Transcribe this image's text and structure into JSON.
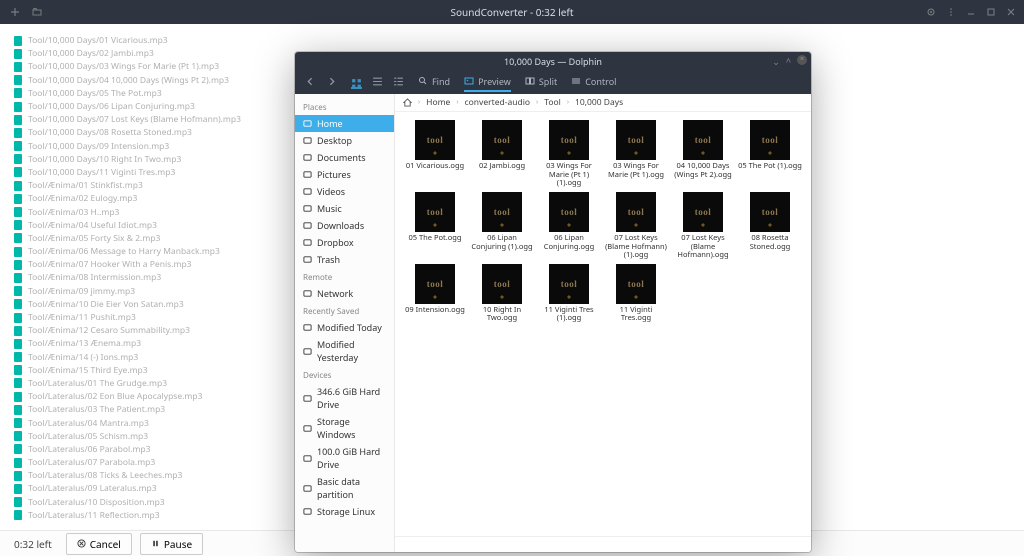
{
  "titlebar": {
    "title": "SoundConverter - 0:32 left",
    "left_icons": [
      "plus-icon",
      "folder-icon"
    ]
  },
  "bottom": {
    "time": "0:32 left",
    "cancel": "Cancel",
    "pause": "Pause"
  },
  "conversion_list": [
    "Tool/10,000 Days/01 Vicarious.mp3",
    "Tool/10,000 Days/02 Jambi.mp3",
    "Tool/10,000 Days/03 Wings For Marie (Pt 1).mp3",
    "Tool/10,000 Days/04 10,000 Days (Wings Pt 2).mp3",
    "Tool/10,000 Days/05 The Pot.mp3",
    "Tool/10,000 Days/06 Lipan Conjuring.mp3",
    "Tool/10,000 Days/07 Lost Keys (Blame Hofmann).mp3",
    "Tool/10,000 Days/08 Rosetta Stoned.mp3",
    "Tool/10,000 Days/09 Intension.mp3",
    "Tool/10,000 Days/10 Right In Two.mp3",
    "Tool/10,000 Days/11 Viginti Tres.mp3",
    "Tool/Ænima/01 Stinkfist.mp3",
    "Tool/Ænima/02 Eulogy.mp3",
    "Tool/Ænima/03 H..mp3",
    "Tool/Ænima/04 Useful Idiot.mp3",
    "Tool/Ænima/05 Forty Six & 2.mp3",
    "Tool/Ænima/06 Message to Harry Manback.mp3",
    "Tool/Ænima/07 Hooker With a Penis.mp3",
    "Tool/Ænima/08 Intermission.mp3",
    "Tool/Ænima/09 jimmy.mp3",
    "Tool/Ænima/10 Die Eier Von Satan.mp3",
    "Tool/Ænima/11 Pushit.mp3",
    "Tool/Ænima/12 Cesaro Summability.mp3",
    "Tool/Ænima/13 Ænema.mp3",
    "Tool/Ænima/14 (-) Ions.mp3",
    "Tool/Ænima/15 Third Eye.mp3",
    "Tool/Lateralus/01 The Grudge.mp3",
    "Tool/Lateralus/02 Eon Blue Apocalypse.mp3",
    "Tool/Lateralus/03 The Patient.mp3",
    "Tool/Lateralus/04 Mantra.mp3",
    "Tool/Lateralus/05 Schism.mp3",
    "Tool/Lateralus/06 Parabol.mp3",
    "Tool/Lateralus/07 Parabola.mp3",
    "Tool/Lateralus/08 Ticks & Leeches.mp3",
    "Tool/Lateralus/09 Lateralus.mp3",
    "Tool/Lateralus/10 Disposition.mp3",
    "Tool/Lateralus/11 Reflection.mp3"
  ],
  "dolphin": {
    "title": "10,000 Days — Dolphin",
    "toolbar": {
      "find": "Find",
      "preview": "Preview",
      "split": "Split",
      "control": "Control"
    },
    "breadcrumb": [
      "Home",
      "converted-audio",
      "Tool",
      "10,000 Days"
    ],
    "sidebar": {
      "places_header": "Places",
      "places": [
        {
          "label": "Home",
          "icon": "home-icon",
          "active": true
        },
        {
          "label": "Desktop",
          "icon": "desktop-icon"
        },
        {
          "label": "Documents",
          "icon": "documents-icon"
        },
        {
          "label": "Pictures",
          "icon": "pictures-icon"
        },
        {
          "label": "Videos",
          "icon": "videos-icon"
        },
        {
          "label": "Music",
          "icon": "music-icon"
        },
        {
          "label": "Downloads",
          "icon": "downloads-icon"
        },
        {
          "label": "Dropbox",
          "icon": "dropbox-icon"
        },
        {
          "label": "Trash",
          "icon": "trash-icon"
        }
      ],
      "remote_header": "Remote",
      "remote": [
        {
          "label": "Network",
          "icon": "network-icon"
        }
      ],
      "recent_header": "Recently Saved",
      "recent": [
        {
          "label": "Modified Today",
          "icon": "today-icon"
        },
        {
          "label": "Modified Yesterday",
          "icon": "yesterday-icon"
        }
      ],
      "devices_header": "Devices",
      "devices": [
        {
          "label": "346.6 GiB Hard Drive",
          "icon": "drive-icon"
        },
        {
          "label": "Storage Windows",
          "icon": "drive-icon"
        },
        {
          "label": "100.0 GiB Hard Drive",
          "icon": "drive-icon"
        },
        {
          "label": "Basic data partition",
          "icon": "drive-icon"
        },
        {
          "label": "Storage Linux",
          "icon": "drive-icon"
        }
      ]
    },
    "files": [
      "01 Vicarious.ogg",
      "02 Jambi.ogg",
      "03 Wings For Marie (Pt 1) (1).ogg",
      "03 Wings For Marie (Pt 1).ogg",
      "04 10,000 Days (Wings Pt 2).ogg",
      "05 The Pot (1).ogg",
      "05 The Pot.ogg",
      "06 Lipan Conjuring (1).ogg",
      "06 Lipan Conjuring.ogg",
      "07 Lost Keys (Blame Hofmann) (1).ogg",
      "07 Lost Keys (Blame Hofmann).ogg",
      "08 Rosetta Stoned.ogg",
      "09 Intension.ogg",
      "10 Right In Two.ogg",
      "11 Viginti Tres (1).ogg",
      "11 Viginti Tres.ogg"
    ]
  }
}
